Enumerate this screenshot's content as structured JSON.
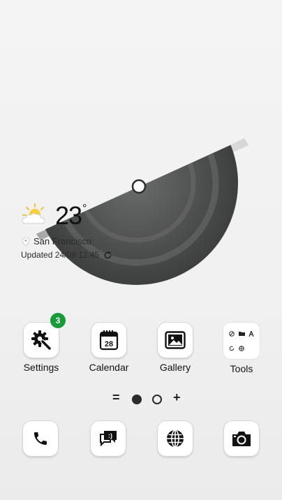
{
  "weather": {
    "temperature": "23",
    "degree_symbol": "°",
    "location": "San Francisco",
    "updated": "Updated 24/09 12:45",
    "condition_icon": "partly-cloudy-icon"
  },
  "apps": [
    {
      "label": "Settings",
      "icon": "settings-icon",
      "badge": "3"
    },
    {
      "label": "Calendar",
      "icon": "calendar-icon",
      "day": "28"
    },
    {
      "label": "Gallery",
      "icon": "gallery-icon"
    },
    {
      "label": "Tools",
      "icon": "tools-folder-icon"
    }
  ],
  "pager": {
    "menu_symbol": "=",
    "add_symbol": "+",
    "pages": 2,
    "current_page": 1
  },
  "dock": [
    {
      "icon": "phone-icon"
    },
    {
      "icon": "messages-icon"
    },
    {
      "icon": "browser-icon"
    },
    {
      "icon": "camera-icon"
    }
  ],
  "colors": {
    "badge": "#1a9b3a",
    "semicircle": "#4a4b4b"
  }
}
